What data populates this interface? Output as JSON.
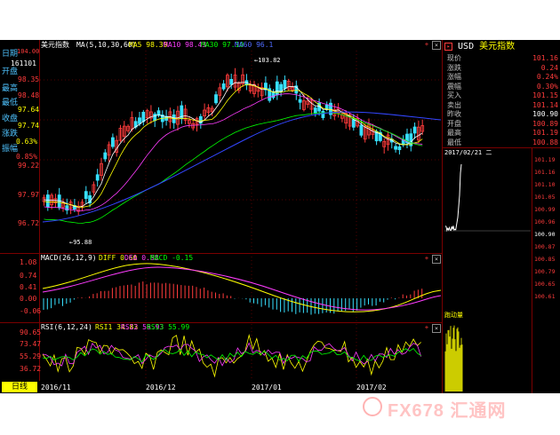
{
  "colors": {
    "rise": "#ff3b3b",
    "fall": "#37e0ff",
    "ma5": "#ffffff",
    "ma10": "#ffff00",
    "ma30": "#ff3cff",
    "ma60": "#00ff00",
    "frame": "#a00000",
    "accent": "#ffff00"
  },
  "main_panel": {
    "instrument": "美元指数",
    "ma_label": "MA(5,10,30,60)",
    "ma5": "MA5 98.39",
    "ma10": "MA10 98.43",
    "ma30": "MA30 97.10",
    "ma60": "MA60 96.1",
    "high_marker": "103.82",
    "low_marker": "95.88",
    "axis_left": [
      "99.22",
      "97.97",
      "96.72"
    ],
    "axis_top_value": "104.00"
  },
  "left_info": {
    "date_label": "日期",
    "date_value": "161101",
    "open_label": "开盘",
    "open_value": "98.35",
    "high_label": "最高",
    "high_value": "98.48",
    "low_label": "最低",
    "low_value": "97.64",
    "close_label": "收盘",
    "close_value": "97.74",
    "change_label": "涨跌",
    "change_value": "0.63%",
    "amplitude_label": "振幅",
    "amplitude_value": "0.85%"
  },
  "macd_panel": {
    "title": "MACD(26,12,9)",
    "diff": "DIFF 0.60",
    "dea": "DEA 0.68",
    "macd": "MACD -0.15",
    "axis": [
      "1.08",
      "0.74",
      "0.41",
      "0.00",
      "-0.06"
    ]
  },
  "rsi_panel": {
    "title": "RSI(6,12,24)",
    "rsi1": "RSI1 34.83",
    "rsi2": "RSI2 56.93",
    "rsi3": "RSI3 55.99",
    "axis": [
      "90.65",
      "73.47",
      "55.29",
      "36.72"
    ]
  },
  "time_axis": {
    "period_button": "日线",
    "dates": [
      "2016/11",
      "2016/12",
      "2017/01",
      "2017/02"
    ]
  },
  "quote_panel": {
    "symbol": "USD",
    "name": "美元指数",
    "rows": [
      {
        "label": "现价",
        "value": "101.16"
      },
      {
        "label": "涨跌",
        "value": "0.24"
      },
      {
        "label": "涨幅",
        "value": "0.24%"
      },
      {
        "label": "震幅",
        "value": "0.30%"
      },
      {
        "label": "买入",
        "value": "101.15"
      },
      {
        "label": "卖出",
        "value": "101.14"
      },
      {
        "label": "昨收",
        "value": "100.90"
      },
      {
        "label": "开盘",
        "value": "100.89"
      },
      {
        "label": "最高",
        "value": "101.19"
      },
      {
        "label": "最低",
        "value": "100.88"
      }
    ]
  },
  "intraday_panel": {
    "header": "2017/02/21 二",
    "axis": [
      "101.19",
      "101.16",
      "101.10",
      "101.05",
      "100.99",
      "100.96",
      "100.90",
      "100.87",
      "100.85",
      "100.79",
      "100.65",
      "100.61"
    ],
    "volume_label": "跑动量"
  },
  "watermark": "FX678 汇通网"
}
